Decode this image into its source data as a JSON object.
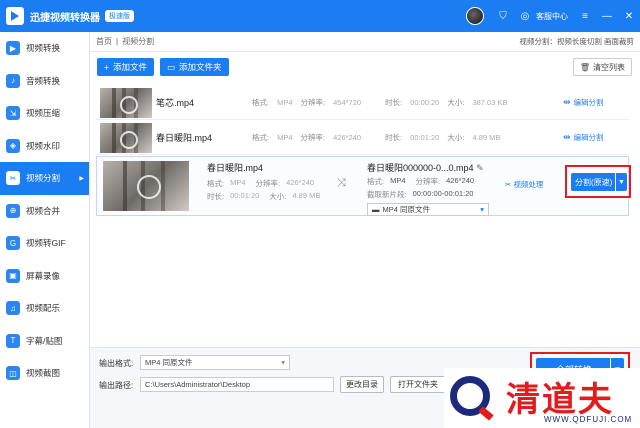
{
  "app": {
    "title": "迅捷视频转换器",
    "badge": "极速版",
    "service": "客服中心"
  },
  "sidebar": {
    "items": [
      {
        "label": "视频转换"
      },
      {
        "label": "音频转换"
      },
      {
        "label": "视频压缩"
      },
      {
        "label": "视频水印"
      },
      {
        "label": "视频分割"
      },
      {
        "label": "视频合并"
      },
      {
        "label": "视频转GIF"
      },
      {
        "label": "屏幕录像"
      },
      {
        "label": "视频配乐"
      },
      {
        "label": "字幕/贴图"
      },
      {
        "label": "视频截图"
      }
    ],
    "active_index": 4
  },
  "breadcrumb": {
    "home": "首页",
    "sep": "|",
    "current": "视频分割",
    "right": "视频分割：视频长度切割 画面裁剪"
  },
  "toolbar": {
    "add_file": "添加文件",
    "add_folder": "添加文件夹",
    "clear": "清空列表"
  },
  "labels": {
    "format": "格式:",
    "resolution": "分辨率:",
    "duration": "时长:",
    "size": "大小:",
    "edit_split": "编辑分割",
    "video_process": "视频处理",
    "clip_segment": "截取新片段:"
  },
  "files": [
    {
      "name": "笔芯.mp4",
      "format": "MP4",
      "resolution": "454*720",
      "duration": "00:00:20",
      "size": "387.03 KB"
    },
    {
      "name": "春日暖阳.mp4",
      "format": "MP4",
      "resolution": "426*240",
      "duration": "00:01:20",
      "size": "4.89 MB"
    }
  ],
  "expanded": {
    "name": "春日暖阳.mp4",
    "format": "MP4",
    "resolution": "426*240",
    "duration": "00:01:20",
    "size": "4.89 MB",
    "output_name": "春日暖阳000000-0...0.mp4",
    "out_format": "MP4",
    "out_resolution": "426*240",
    "clip_range": "00:00:00-00:01:20",
    "out_select": "MP4   同原文件",
    "split_button": "分割(原速)"
  },
  "bottom": {
    "format_label": "输出格式:",
    "format_value": "MP4   同原文件",
    "path_label": "输出路径:",
    "path_value": "C:\\Users\\Administrator\\Desktop",
    "change_dir": "更改目录",
    "open_folder": "打开文件夹",
    "convert_all": "全部转换"
  },
  "watermark": {
    "text": "清道夫",
    "url": "WWW.QDFUJI.COM"
  },
  "colors": {
    "primary": "#1a7ef2",
    "highlight_border": "#e21c1c",
    "watermark_red": "#e21c1c",
    "watermark_navy": "#1b2a7a"
  }
}
